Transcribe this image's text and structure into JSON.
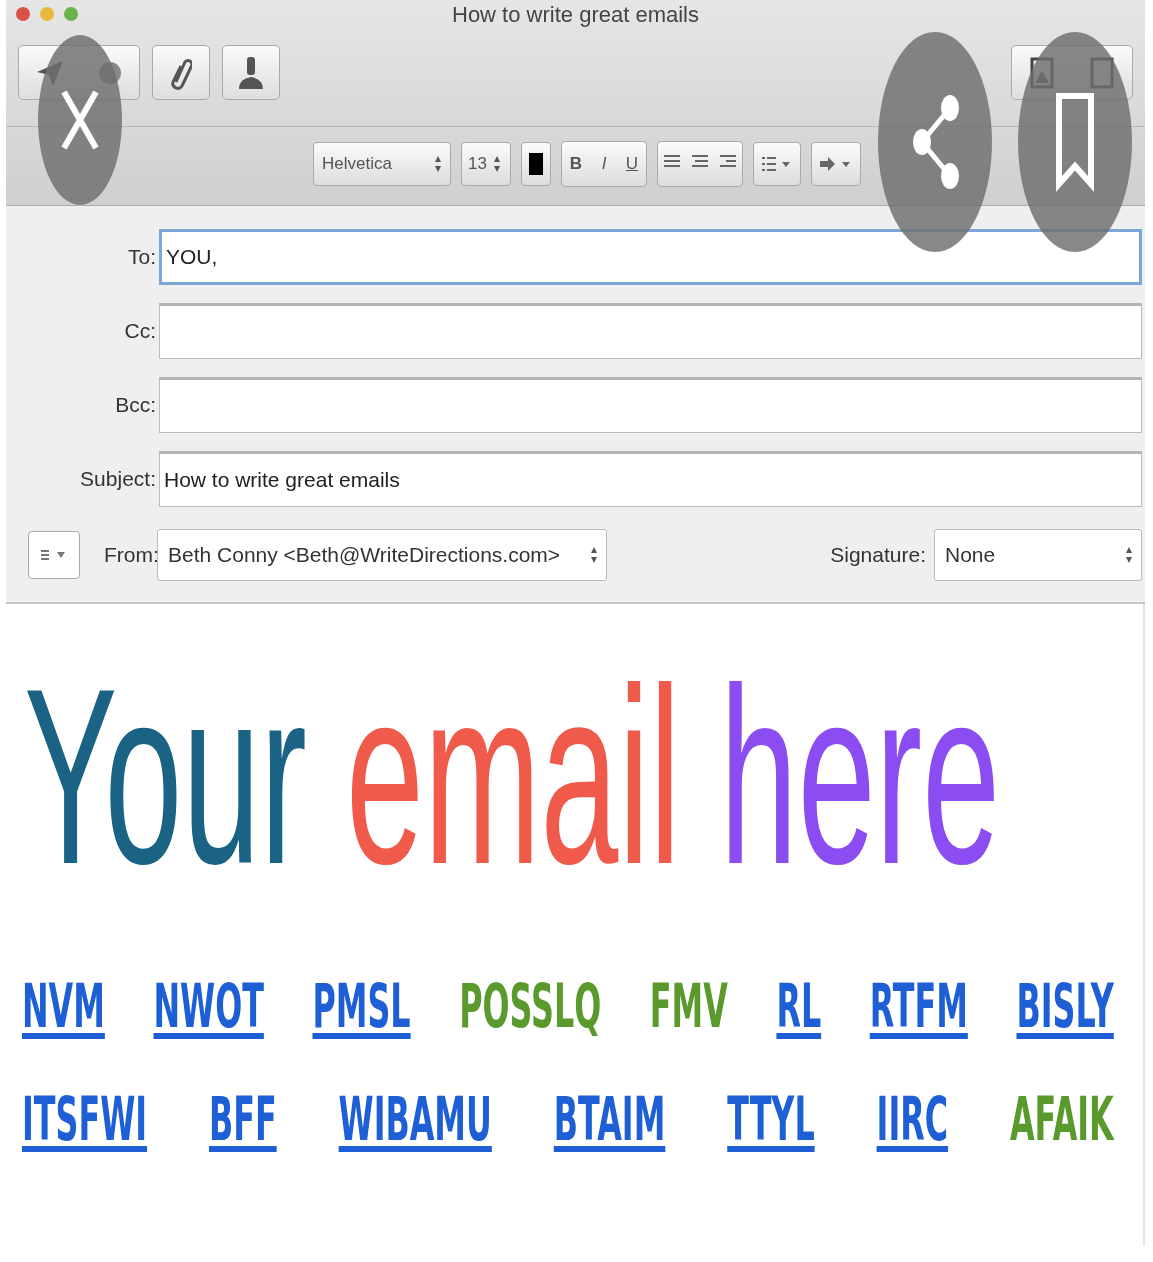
{
  "window": {
    "title": "How to write great emails"
  },
  "format_bar": {
    "font": "Helvetica",
    "size": "13",
    "style_buttons": [
      "B",
      "I",
      "U"
    ]
  },
  "fields": [
    {
      "label": "To:",
      "value": "YOU,",
      "focused": true
    },
    {
      "label": "Cc:",
      "focused": false
    },
    {
      "label": "Bcc:",
      "focused": false
    },
    {
      "label": "Subject:",
      "value": "How to write great emails",
      "focused": false
    }
  ],
  "from": {
    "label": "From:",
    "value": "Beth Conny <Beth@WriteDirections.com>"
  },
  "signature": {
    "label": "Signature:",
    "value": "None"
  },
  "body": {
    "headline": [
      {
        "text": "Your",
        "color": "#1b6385"
      },
      {
        "text": "email",
        "color": "#f05a4b"
      },
      {
        "text": "here",
        "color": "#8b4df2"
      }
    ],
    "rows": [
      {
        "items": [
          {
            "text": "NVM",
            "color": "#1f5fd6",
            "linked": true
          },
          {
            "text": "NWOT",
            "color": "#1f5fd6",
            "linked": true
          },
          {
            "text": "PMSL",
            "color": "#1f5fd6",
            "linked": true
          },
          {
            "text": "POSSLQ",
            "color": "#5a9a2c",
            "linked": false
          },
          {
            "text": "FMV",
            "color": "#5a9a2c",
            "linked": false
          },
          {
            "text": "RL",
            "color": "#1f5fd6",
            "linked": true
          },
          {
            "text": "RTFM",
            "color": "#1f5fd6",
            "linked": true
          },
          {
            "text": "BISLY",
            "color": "#1f5fd6",
            "linked": true
          }
        ]
      },
      {
        "items": [
          {
            "text": "ITSFWI",
            "color": "#1f5fd6",
            "linked": true
          },
          {
            "text": "BFF",
            "color": "#1f5fd6",
            "linked": true
          },
          {
            "text": "WIBAMU",
            "color": "#1f5fd6",
            "linked": true
          },
          {
            "text": "BTAIM",
            "color": "#1f5fd6",
            "linked": true
          },
          {
            "text": "TTYL",
            "color": "#1f5fd6",
            "linked": true
          },
          {
            "text": "IIRC",
            "color": "#1f5fd6",
            "linked": true
          },
          {
            "text": "AFAIK",
            "color": "#5a9a2c",
            "linked": false
          }
        ]
      }
    ]
  },
  "overlay": {
    "buttons": [
      {
        "kind": "close"
      },
      {
        "kind": "share"
      },
      {
        "kind": "bookmark"
      }
    ]
  }
}
